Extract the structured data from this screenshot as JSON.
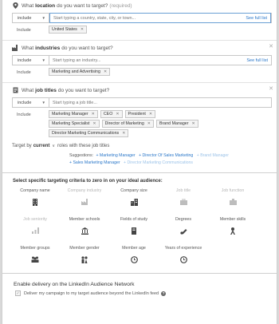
{
  "location": {
    "q_prefix": "What",
    "q_bold": "location",
    "q_suffix": "do you want to target?",
    "required": "(required)",
    "include_label": "include",
    "search_placeholder": "Start typing a country, state, city, or town...",
    "full_list": "See full list",
    "tags_label": "Include",
    "tags": [
      "United States"
    ]
  },
  "industries": {
    "q_prefix": "What",
    "q_bold": "industries",
    "q_suffix": "do you want to target?",
    "include_label": "include",
    "search_placeholder": "Start typing an industry...",
    "full_list": "See full list",
    "tags_label": "Include",
    "tags": [
      "Marketing and Advertising"
    ]
  },
  "job_titles": {
    "q_prefix": "What",
    "q_bold": "job titles",
    "q_suffix": "do you want to target?",
    "include_label": "include",
    "search_placeholder": "Start typing a job title...",
    "tags_label": "Include",
    "tags": [
      "Marketing Manager",
      "CEO",
      "President",
      "Marketing Specialist",
      "Director of Marketing",
      "Brand Manager",
      "Director Marketing Communications"
    ]
  },
  "target_by": {
    "prefix": "Target by",
    "mode": "current",
    "suffix": "roles with these job titles"
  },
  "suggestions": {
    "label": "Suggestions:",
    "items": [
      {
        "text": "+ Marketing Manager",
        "dim": false
      },
      {
        "text": "+ Director Of Sales Marketing",
        "dim": false
      },
      {
        "text": "+ Brand Manager",
        "dim": true
      },
      {
        "text": "+ Sales Marketing Manager",
        "dim": false
      },
      {
        "text": "+ Director Marketing Communications",
        "dim": true
      }
    ]
  },
  "criteria": {
    "title": "Select specific targeting criteria to zero in on your ideal audience:",
    "items": [
      {
        "label": "Company name",
        "icon": "building-icon",
        "dim": false
      },
      {
        "label": "Company industry",
        "icon": "factory-icon",
        "dim": true
      },
      {
        "label": "Company size",
        "icon": "building-size-icon",
        "dim": false
      },
      {
        "label": "Job title",
        "icon": "briefcase-icon",
        "dim": true
      },
      {
        "label": "Job function",
        "icon": "job-function-icon",
        "dim": true
      },
      {
        "label": "Job seniority",
        "icon": "seniority-icon",
        "dim": true
      },
      {
        "label": "Member schools",
        "icon": "school-icon",
        "dim": false
      },
      {
        "label": "Fields of study",
        "icon": "book-icon",
        "dim": false
      },
      {
        "label": "Degrees",
        "icon": "diploma-icon",
        "dim": false
      },
      {
        "label": "Member skills",
        "icon": "skills-icon",
        "dim": false
      },
      {
        "label": "Member groups",
        "icon": "groups-icon",
        "dim": false
      },
      {
        "label": "Member gender",
        "icon": "gender-icon",
        "dim": false
      },
      {
        "label": "Member age",
        "icon": "age-clock-icon",
        "dim": false
      },
      {
        "label": "Years of experience",
        "icon": "experience-clock-icon",
        "dim": false
      }
    ]
  },
  "delivery": {
    "heading": "Enable delivery on the LinkedIn Audience Network",
    "checkbox_label": "Deliver my campaign to my target audience beyond the LinkedIn feed",
    "checked": true
  },
  "colors": {
    "link": "#2a77c9",
    "link_dim": "#9cc3e8",
    "focus_border": "#6a9fd4"
  }
}
